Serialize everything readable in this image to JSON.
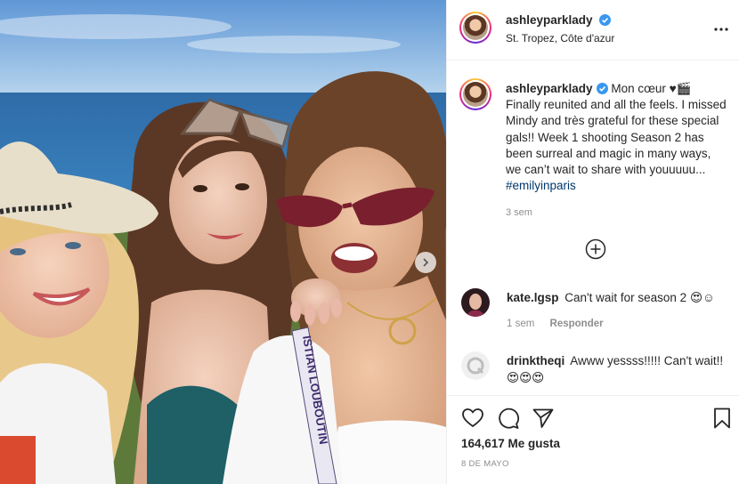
{
  "post": {
    "author": "ashleyparklady",
    "location": "St. Tropez, Côte d'azur",
    "caption_lead": "Mon cœur ♥🎬 Finally reunited and all the feels. I missed Mindy and très grateful for these special gals!! Week 1 shooting Season 2 has been surreal and magic in many ways, we can’t wait to share with youuuuu... ",
    "caption_hashtag": "#emilyinparis",
    "caption_time": "3 sem",
    "likes": "164,617 Me gusta",
    "date": "8 DE MAYO",
    "sash_text": "ISTIAN LOUBOUTIN"
  },
  "comments": [
    {
      "user": "kate.lgsp",
      "text": "Can't wait for season 2 😍☺",
      "time": "1 sem",
      "reply_label": "Responder"
    },
    {
      "user": "drinktheqi",
      "text": "Awww yessss!!!!! Can't wait!! 😍😍😍"
    }
  ],
  "icons": {
    "verified": "verified-badge-icon",
    "more": "more-options-icon",
    "load_more": "plus-circle-icon",
    "like": "heart-icon",
    "comment": "comment-icon",
    "share": "paper-plane-icon",
    "save": "bookmark-icon",
    "next": "chevron-right-icon"
  },
  "colors": {
    "accent_link": "#00376b",
    "verified": "#3897f0",
    "muted": "#8e8e8e"
  }
}
